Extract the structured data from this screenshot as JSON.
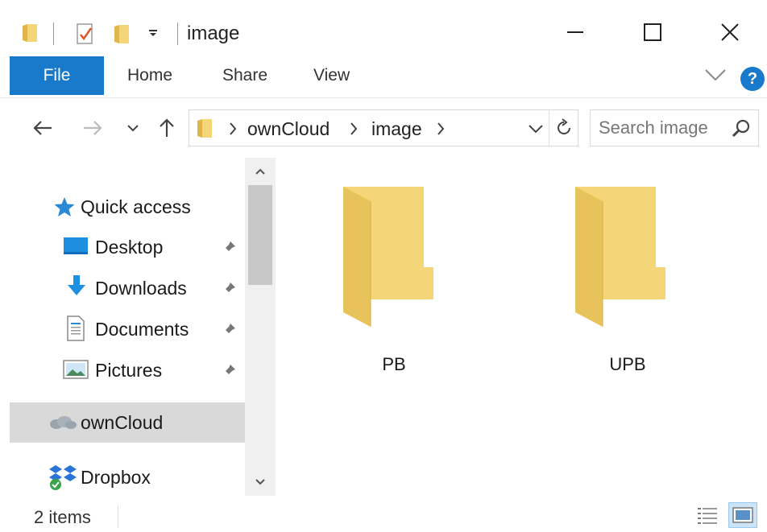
{
  "window": {
    "title": "image",
    "controls": {
      "minimize": "—",
      "maximize": "☐",
      "close": "✕"
    }
  },
  "ribbon": {
    "file_label": "File",
    "tabs": [
      "Home",
      "Share",
      "View"
    ],
    "help_label": "?"
  },
  "address": {
    "crumbs": [
      "ownCloud",
      "image"
    ]
  },
  "search": {
    "placeholder": "Search image"
  },
  "navpane": {
    "quick_access": "Quick access",
    "items": [
      {
        "label": "Desktop",
        "icon": "desktop-icon"
      },
      {
        "label": "Downloads",
        "icon": "downloads-icon"
      },
      {
        "label": "Documents",
        "icon": "documents-icon"
      },
      {
        "label": "Pictures",
        "icon": "pictures-icon"
      }
    ],
    "owncloud": "ownCloud",
    "dropbox": "Dropbox"
  },
  "content": {
    "folders": [
      {
        "name": "PB"
      },
      {
        "name": "UPB"
      }
    ]
  },
  "status": {
    "items_count": "2 items"
  },
  "colors": {
    "accent": "#1979ca",
    "folder": "#f4d679",
    "folder_dark": "#e8c25a",
    "selected": "#d9d9d9"
  }
}
